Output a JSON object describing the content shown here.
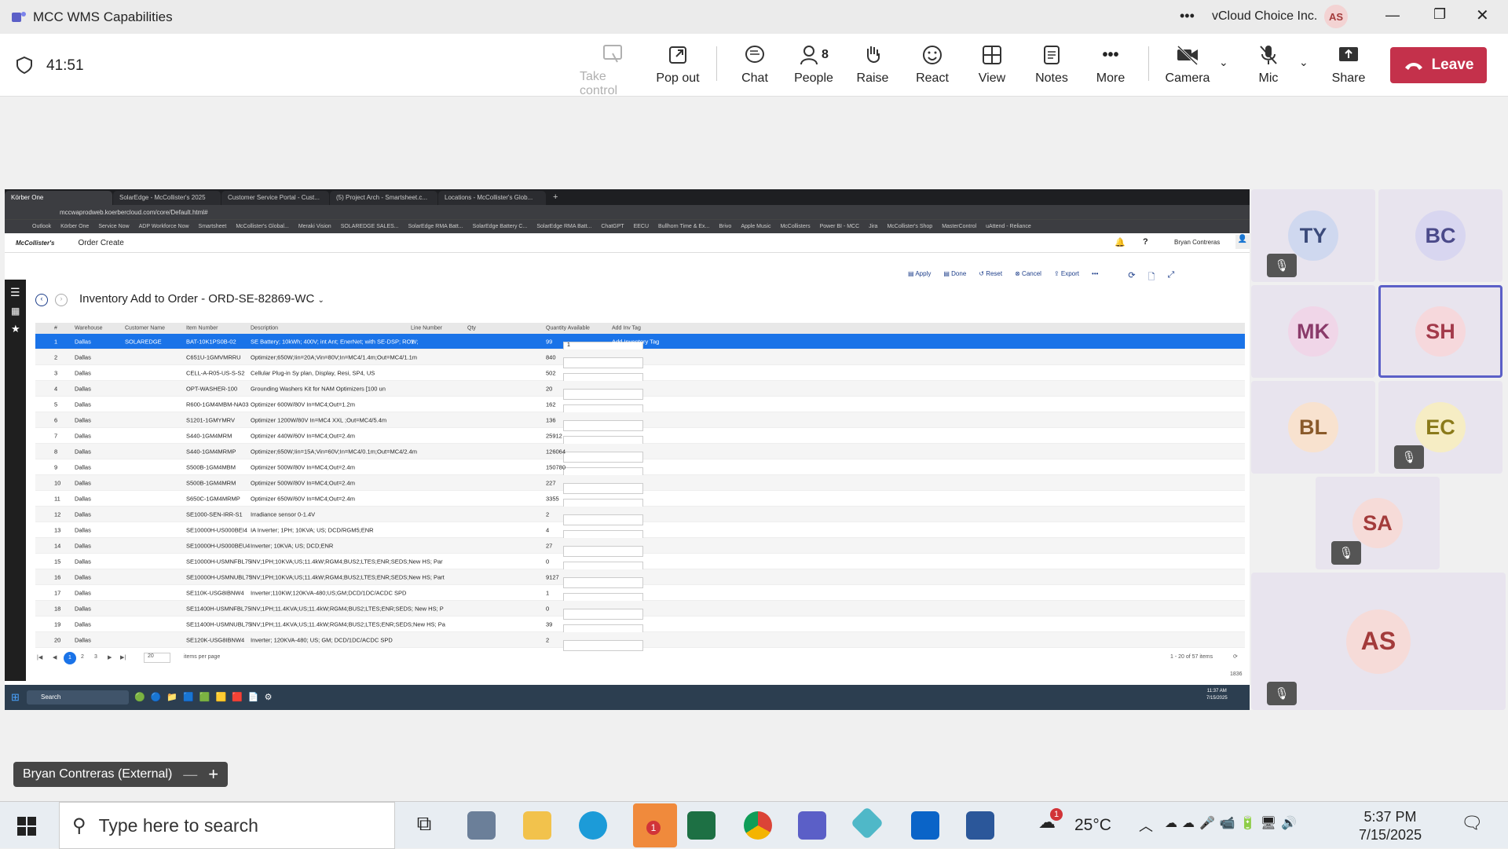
{
  "window": {
    "title": "MCC WMS Capabilities",
    "org": "vCloud Choice Inc.",
    "user_initials": "AS"
  },
  "meeting": {
    "timer": "41:51",
    "people_count": "8"
  },
  "toolbar": {
    "take_control": "Take control",
    "pop_out": "Pop out",
    "chat": "Chat",
    "people": "People",
    "raise": "Raise",
    "react": "React",
    "view": "View",
    "notes": "Notes",
    "more": "More",
    "camera": "Camera",
    "mic": "Mic",
    "share": "Share",
    "leave": "Leave"
  },
  "browser": {
    "tabs": [
      "Körber One",
      "SolarEdge - McCollister's 2025",
      "Customer Service Portal - Cust...",
      "(5) Project Arch - Smartsheet.c...",
      "Locations - McCollister's Glob..."
    ],
    "url": "mccwaprodweb.koerbercloud.com/core/Default.html#",
    "bookmarks": [
      "Outlook",
      "Körber One",
      "Service Now",
      "ADP Workforce Now",
      "Smartsheet",
      "McCollister's Global...",
      "Meraki Vision",
      "SOLAREDGE SALES...",
      "SolarEdge RMA Batt...",
      "SolarEdge Battery C...",
      "SolarEdge RMA Batt...",
      "ChatGPT",
      "EECU",
      "Bullhorn Time & Ex...",
      "Brivo",
      "Apple Music",
      "McCollisters",
      "Power BI - MCC",
      "Jira",
      "McCollister's Shop",
      "MasterControl",
      "uAttend - Reliance"
    ]
  },
  "app": {
    "brand": "McCollister's",
    "nav": "Order Create",
    "user": "Bryan Contreras",
    "page_title": "Inventory Add to Order - ORD-SE-82869-WC",
    "actions": [
      "Apply",
      "Done",
      "Reset",
      "Cancel",
      "Export"
    ]
  },
  "grid": {
    "columns": [
      "#",
      "Warehouse",
      "Customer Name",
      "Item Number",
      "Description",
      "Line Number",
      "Qty",
      "Quantity Available",
      "Add Inv Tag"
    ],
    "rows": [
      [
        "1",
        "Dallas",
        "SOLAREDGE",
        "BAT-10K1PS0B-02",
        "SE Battery; 10kWh; 400V; int Ant; EnerNet; with SE-DSP; ROW;",
        "1",
        "1",
        "99",
        "Add Inventory Tag"
      ],
      [
        "2",
        "Dallas",
        "",
        "C651U-1GMVMRRU",
        "Optimizer;650W;Iin=20A;Vin=80V;In=MC4/1.4m;Out=MC4/1.1m",
        "",
        "",
        "840",
        ""
      ],
      [
        "3",
        "Dallas",
        "",
        "CELL-A-R05-US-S-S2",
        "Cellular Plug-in Sy plan, Display, Resi, SP4, US",
        "",
        "",
        "502",
        ""
      ],
      [
        "4",
        "Dallas",
        "",
        "OPT-WASHER-100",
        "Grounding Washers Kit for NAM Optimizers [100 un",
        "",
        "",
        "20",
        ""
      ],
      [
        "5",
        "Dallas",
        "",
        "R600-1GM4MBM-NA03",
        "Optimizer 600W/80V In=MC4;Out=1.2m",
        "",
        "",
        "162",
        ""
      ],
      [
        "6",
        "Dallas",
        "",
        "S1201-1GMYMRV",
        "Optimizer 1200W/80V In=MC4 XXL ;Out=MC4/5.4m",
        "",
        "",
        "136",
        ""
      ],
      [
        "7",
        "Dallas",
        "",
        "S440-1GM4MRM",
        "Optimizer 440W/60V In=MC4;Out=2.4m",
        "",
        "",
        "25912",
        ""
      ],
      [
        "8",
        "Dallas",
        "",
        "S440-1GM4MRMP",
        "Optimizer;650W;Iin=15A;Vin=60V;In=MC4/0.1m;Out=MC4/2.4m",
        "",
        "",
        "126064",
        ""
      ],
      [
        "9",
        "Dallas",
        "",
        "S500B-1GM4MBM",
        "Optimizer 500W/80V In=MC4;Out=2.4m",
        "",
        "",
        "150780",
        ""
      ],
      [
        "10",
        "Dallas",
        "",
        "S500B-1GM4MRM",
        "Optimizer 500W/80V In=MC4;Out=2.4m",
        "",
        "",
        "227",
        ""
      ],
      [
        "11",
        "Dallas",
        "",
        "S650C-1GM4MRMP",
        "Optimizer 650W/60V In=MC4;Out=2.4m",
        "",
        "",
        "3355",
        ""
      ],
      [
        "12",
        "Dallas",
        "",
        "SE1000-SEN-IRR-S1",
        "Irradiance sensor 0-1.4V",
        "",
        "",
        "2",
        ""
      ],
      [
        "13",
        "Dallas",
        "",
        "SE10000H-US000BEI4",
        "IA Inverter; 1PH; 10KVA; US; DCD/RGM5;ENR",
        "",
        "",
        "4",
        ""
      ],
      [
        "14",
        "Dallas",
        "",
        "SE10000H-US000BEU4",
        "Inverter; 10KVA; US; DCD;ENR",
        "",
        "",
        "27",
        ""
      ],
      [
        "15",
        "Dallas",
        "",
        "SE10000H-USMNFBL75",
        "INV;1PH;10KVA;US;11.4kW;RGM4;BUS2;LTES;ENR;SEDS;New HS; Par",
        "",
        "",
        "0",
        ""
      ],
      [
        "16",
        "Dallas",
        "",
        "SE10000H-USMNUBL75",
        "INV;1PH;10KVA;US;11.4kW;RGM4;BUS2;LTES;ENR;SEDS;New HS; Part",
        "",
        "",
        "9127",
        ""
      ],
      [
        "17",
        "Dallas",
        "",
        "SE110K-USG8IBNW4",
        "Inverter;110KW;120KVA-480;US;GM;DCD/1DC/ACDC SPD",
        "",
        "",
        "1",
        ""
      ],
      [
        "18",
        "Dallas",
        "",
        "SE11400H-USMNFBL75",
        "INV;1PH;11.4KVA;US;11.4kW;RGM4;BUS2;LTES;ENR;SEDS; New HS; P",
        "",
        "",
        "0",
        ""
      ],
      [
        "19",
        "Dallas",
        "",
        "SE11400H-USMNUBL75",
        "INV;1PH;11.4KVA;US;11.4kW;RGM4;BUS2;LTES;ENR;SEDS;New HS; Pa",
        "",
        "",
        "39",
        ""
      ],
      [
        "20",
        "Dallas",
        "",
        "SE120K-USG8IBNW4",
        "Inverter; 120KVA-480; US; GM; DCD/1DC/ACDC SPD",
        "",
        "",
        "2",
        ""
      ]
    ],
    "pager": {
      "pages": [
        "1",
        "2",
        "3"
      ],
      "page_size": "20",
      "per_page_label": "items per page",
      "summary": "1 - 20 of 57 items",
      "footer_num": "1836"
    }
  },
  "share_taskbar": {
    "search": "Search",
    "time": "11:37 AM",
    "date": "7/15/2025"
  },
  "participants": [
    {
      "initials": "TY",
      "muted": true,
      "color": "#cfd8ef",
      "fg": "#3b4a7a"
    },
    {
      "initials": "BC",
      "muted": false,
      "color": "#d8d6f0",
      "fg": "#4b4a8a"
    },
    {
      "initials": "MK",
      "muted": false,
      "color": "#f0d6e8",
      "fg": "#8a3b6a"
    },
    {
      "initials": "SH",
      "muted": false,
      "color": "#f6d8dc",
      "fg": "#a33b4b"
    },
    {
      "initials": "BL",
      "muted": false,
      "color": "#f8e2cf",
      "fg": "#8a5a2a"
    },
    {
      "initials": "EC",
      "muted": true,
      "color": "#f6edc4",
      "fg": "#8a7a1a"
    },
    {
      "initials": "SA",
      "muted": true,
      "color": "#f6dbd8",
      "fg": "#a33b3b"
    },
    {
      "initials": "AS",
      "muted": true,
      "color": "#f6dbd8",
      "fg": "#a33b3b"
    }
  ],
  "presenter": {
    "name": "Bryan Contreras (External)"
  },
  "taskbar": {
    "search_placeholder": "Type here to search",
    "temperature": "25°C",
    "time": "5:37 PM",
    "date": "7/15/2025",
    "notif_count": "1",
    "teams_badge": "1"
  }
}
